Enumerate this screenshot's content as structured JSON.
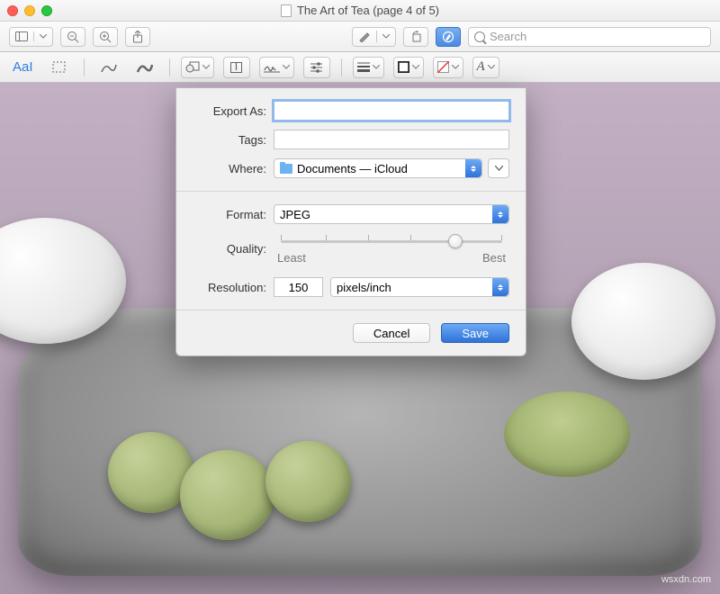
{
  "window": {
    "title": "The Art of Tea (page 4 of 5)"
  },
  "toolbar": {
    "search_placeholder": "Search"
  },
  "markup": {
    "text_style": "AaI"
  },
  "dialog": {
    "export_as_label": "Export As:",
    "export_as_value": "",
    "tags_label": "Tags:",
    "tags_value": "",
    "where_label": "Where:",
    "where_value": "Documents — iCloud",
    "format_label": "Format:",
    "format_value": "JPEG",
    "quality_label": "Quality:",
    "quality_least": "Least",
    "quality_best": "Best",
    "quality_position_pct": 78,
    "resolution_label": "Resolution:",
    "resolution_value": "150",
    "resolution_unit": "pixels/inch",
    "cancel": "Cancel",
    "save": "Save"
  },
  "watermark": "wsxdn.com",
  "colors": {
    "accent": "#2f72d8"
  }
}
